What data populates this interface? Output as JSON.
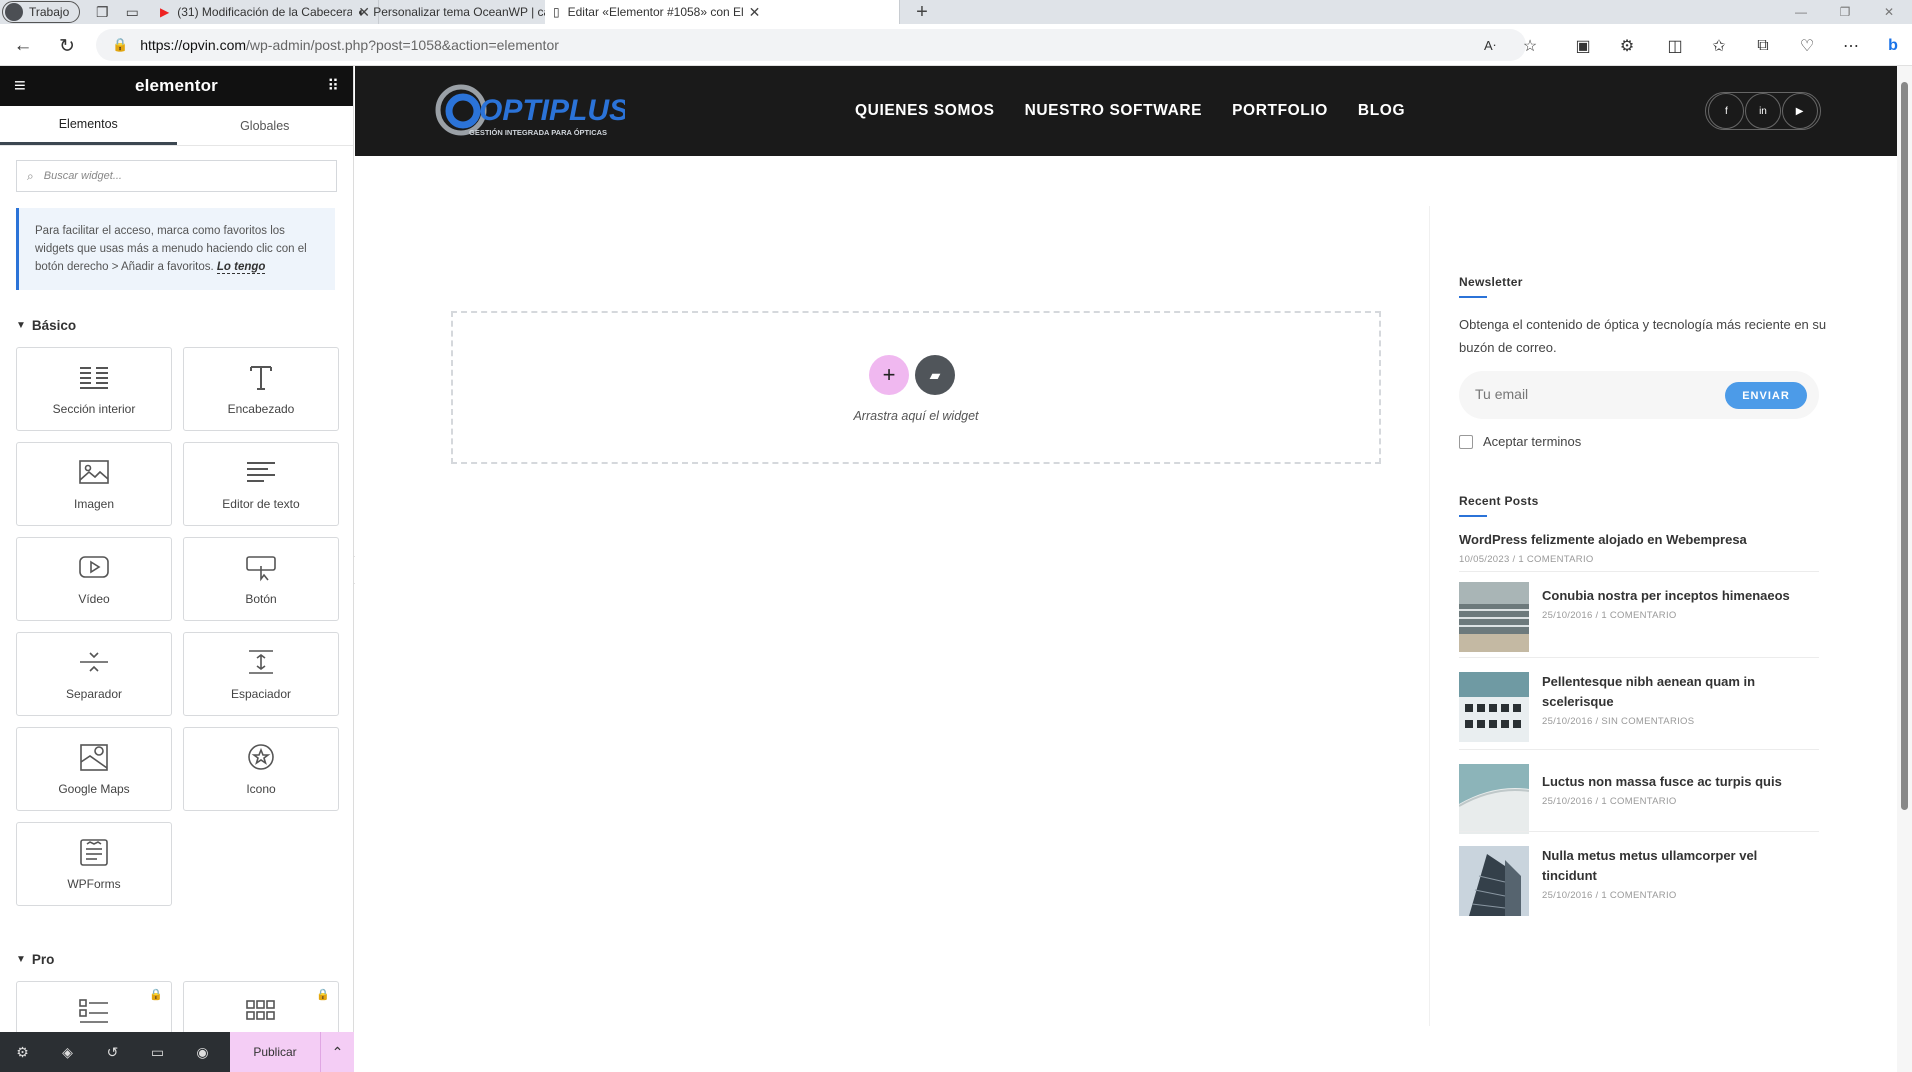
{
  "browser": {
    "profile_label": "Trabajo",
    "tabs": [
      {
        "title": "(31) Modificación de la Cabecera",
        "icon": "youtube-icon"
      },
      {
        "title": "Personalizar tema OceanWP | cab",
        "icon": "wordpress-icon"
      },
      {
        "title": "Editar «Elementor #1058» con El",
        "icon": "page-icon"
      }
    ],
    "url_host": "https://opvin.com",
    "url_path": "/wp-admin/post.php?post=1058&action=elementor"
  },
  "panel": {
    "logo": "elementor",
    "tabs": [
      "Elementos",
      "Globales"
    ],
    "search_placeholder": "Buscar widget...",
    "notice_text": "Para facilitar el acceso, marca como favoritos los widgets que usas más a menudo haciendo clic con el botón derecho > Añadir a favoritos.",
    "notice_link": "Lo tengo",
    "basic_label": "Básico",
    "pro_label": "Pro",
    "widgets": [
      {
        "label": "Sección interior",
        "icon": "inner-section-icon"
      },
      {
        "label": "Encabezado",
        "icon": "heading-icon"
      },
      {
        "label": "Imagen",
        "icon": "image-icon"
      },
      {
        "label": "Editor de texto",
        "icon": "text-editor-icon"
      },
      {
        "label": "Vídeo",
        "icon": "video-icon"
      },
      {
        "label": "Botón",
        "icon": "button-icon"
      },
      {
        "label": "Separador",
        "icon": "divider-icon"
      },
      {
        "label": "Espaciador",
        "icon": "spacer-icon"
      },
      {
        "label": "Google Maps",
        "icon": "google-maps-icon"
      },
      {
        "label": "Icono",
        "icon": "star-icon"
      },
      {
        "label": "WPForms",
        "icon": "wpforms-icon"
      }
    ],
    "publish_label": "Publicar"
  },
  "site": {
    "logo_text": "OPTIPLUS",
    "logo_tagline": "GESTIÓN INTEGRADA PARA ÓPTICAS",
    "nav": [
      "QUIENES SOMOS",
      "NUESTRO SOFTWARE",
      "PORTFOLIO",
      "BLOG"
    ],
    "dropzone_text": "Arrastra aquí el widget",
    "newsletter": {
      "title": "Newsletter",
      "text": "Obtenga el contenido de óptica y tecnología más reciente en su buzón de correo.",
      "placeholder": "Tu email",
      "button": "ENVIAR",
      "checkbox": "Aceptar terminos"
    },
    "recent_posts_title": "Recent Posts",
    "posts": [
      {
        "title": "WordPress felizmente alojado en Webempresa",
        "date": "10/05/2023",
        "comments": "1 COMENTARIO"
      },
      {
        "title": "Conubia nostra per inceptos himenaeos",
        "date": "25/10/2016",
        "comments": "1 COMENTARIO"
      },
      {
        "title": "Pellentesque nibh aenean quam in scelerisque",
        "date": "25/10/2016",
        "comments": "SIN COMENTARIOS"
      },
      {
        "title": "Luctus non massa fusce ac turpis quis",
        "date": "25/10/2016",
        "comments": "1 COMENTARIO"
      },
      {
        "title": "Nulla metus metus ullamcorper vel tincidunt",
        "date": "25/10/2016",
        "comments": "1 COMENTARIO"
      }
    ]
  },
  "colors": {
    "accent_blue": "#2b73d8",
    "elementor_pink": "#f0b8f0",
    "header_dark": "#1a1a1a"
  }
}
